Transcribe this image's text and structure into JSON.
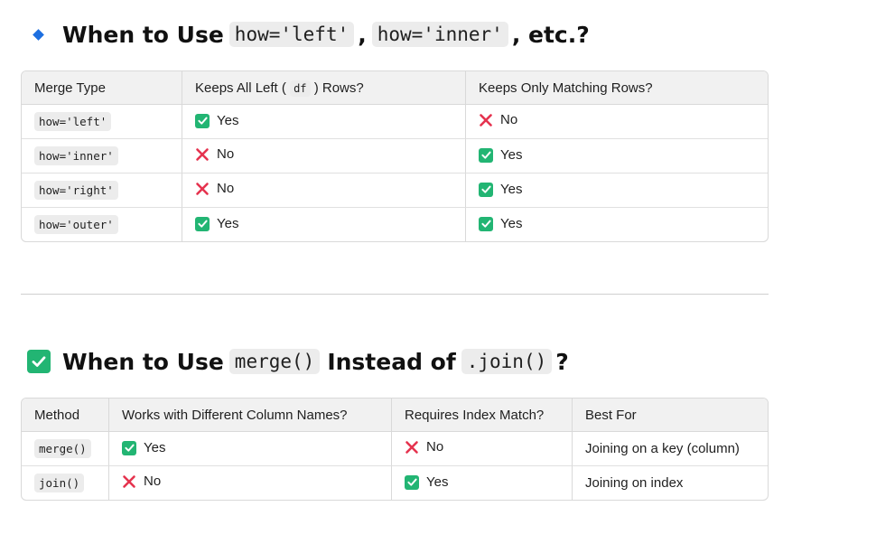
{
  "section1": {
    "title_parts": [
      "When to Use",
      "how='left'",
      ",",
      "how='inner'",
      ", etc.?"
    ],
    "table": {
      "headers": [
        "Merge Type",
        "Keeps All Left (",
        "df",
        ") Rows?",
        "Keeps Only Matching Rows?"
      ],
      "rows": [
        {
          "type": "how='left'",
          "left": "Yes",
          "match": "No"
        },
        {
          "type": "how='inner'",
          "left": "No",
          "match": "Yes"
        },
        {
          "type": "how='right'",
          "left": "No",
          "match": "Yes"
        },
        {
          "type": "how='outer'",
          "left": "Yes",
          "match": "Yes"
        }
      ]
    }
  },
  "section2": {
    "title_parts": [
      "When to Use",
      "merge()",
      "Instead of",
      ".join()",
      "?"
    ],
    "table": {
      "headers": [
        "Method",
        "Works with Different Column Names?",
        "Requires Index Match?",
        "Best For"
      ],
      "rows": [
        {
          "method": "merge()",
          "diff_cols": "Yes",
          "index": "No",
          "best": "Joining on a key (column)"
        },
        {
          "method": "join()",
          "diff_cols": "No",
          "index": "Yes",
          "best": "Joining on index"
        }
      ]
    }
  },
  "icons": {
    "yes": "green-check-icon",
    "no": "red-cross-icon",
    "bullet": "blue-diamond-icon"
  },
  "colors": {
    "yes": "#22b573",
    "no": "#e5334f",
    "bullet": "#1d6fe0"
  }
}
